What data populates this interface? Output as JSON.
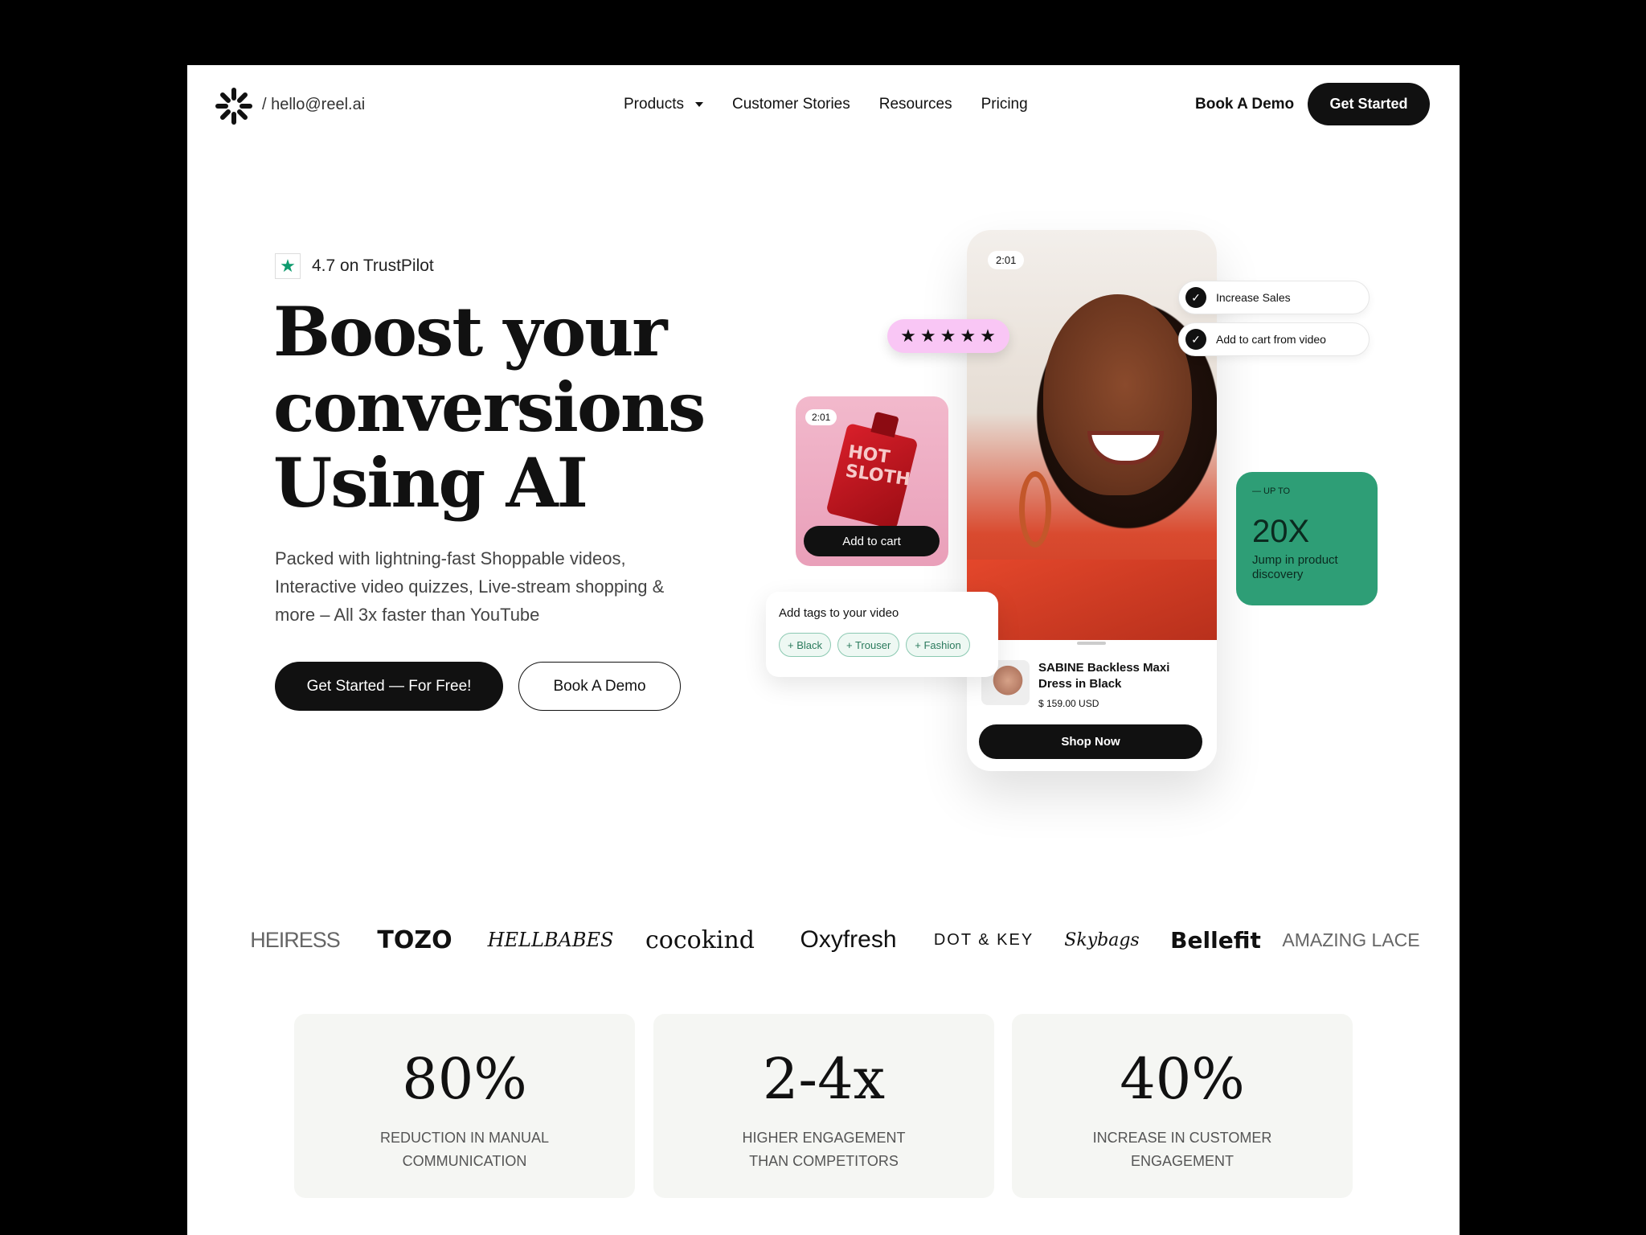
{
  "header": {
    "email": "/ hello@reel.ai",
    "nav": [
      "Products",
      "Customer Stories",
      "Resources",
      "Pricing"
    ],
    "book_demo": "Book A Demo",
    "get_started": "Get Started"
  },
  "hero": {
    "rating_value": "4.7",
    "rating_label": "on TrustPilot",
    "title_lines": [
      "Boost your",
      "conversions",
      "Using AI"
    ],
    "subtitle_lines": [
      "Packed with lightning-fast Shoppable videos,",
      "Interactive video quizzes, Live-stream shopping &",
      "more – All 3x faster than YouTube"
    ],
    "cta_primary": "Get Started — For Free!",
    "cta_secondary": "Book A Demo"
  },
  "phone": {
    "time": "2:01",
    "product_name": "SABINE Backless Maxi Dress in Black",
    "product_price": "$ 159.00 USD",
    "shop_button": "Shop Now"
  },
  "rating_stars": 5,
  "checklist": [
    "Increase Sales",
    "Add to cart from video"
  ],
  "stat_card": {
    "label": "— UP TO",
    "value": "20X",
    "description": "Jump in product discovery"
  },
  "bottle_card": {
    "time": "2:01",
    "label": "HOT SLOTH",
    "add_to_cart": "Add to cart"
  },
  "tags_card": {
    "title": "Add tags to your video",
    "tags": [
      "+ Black",
      "+ Trouser",
      "+ Fashion"
    ]
  },
  "brands": [
    "HEIRESS",
    "TOZO",
    "HELLBABES",
    "cocokind",
    "Oxyfresh",
    "DOT & KEY",
    "Skybags",
    "Bellefit",
    "AMAZING LACE"
  ],
  "stats": [
    {
      "value": "80%",
      "label_lines": [
        "REDUCTION IN MANUAL",
        "COMMUNICATION"
      ]
    },
    {
      "value": "2-4x",
      "label_lines": [
        "HIGHER ENGAGEMENT",
        "THAN COMPETITORS"
      ]
    },
    {
      "value": "40%",
      "label_lines": [
        "INCREASE IN CUSTOMER",
        "ENGAGEMENT"
      ]
    }
  ],
  "colors": {
    "primary": "#111111",
    "accent_green": "#2e9e76",
    "rating_pink": "#f9c6f5",
    "trustpilot_green": "#0f9b6e"
  }
}
